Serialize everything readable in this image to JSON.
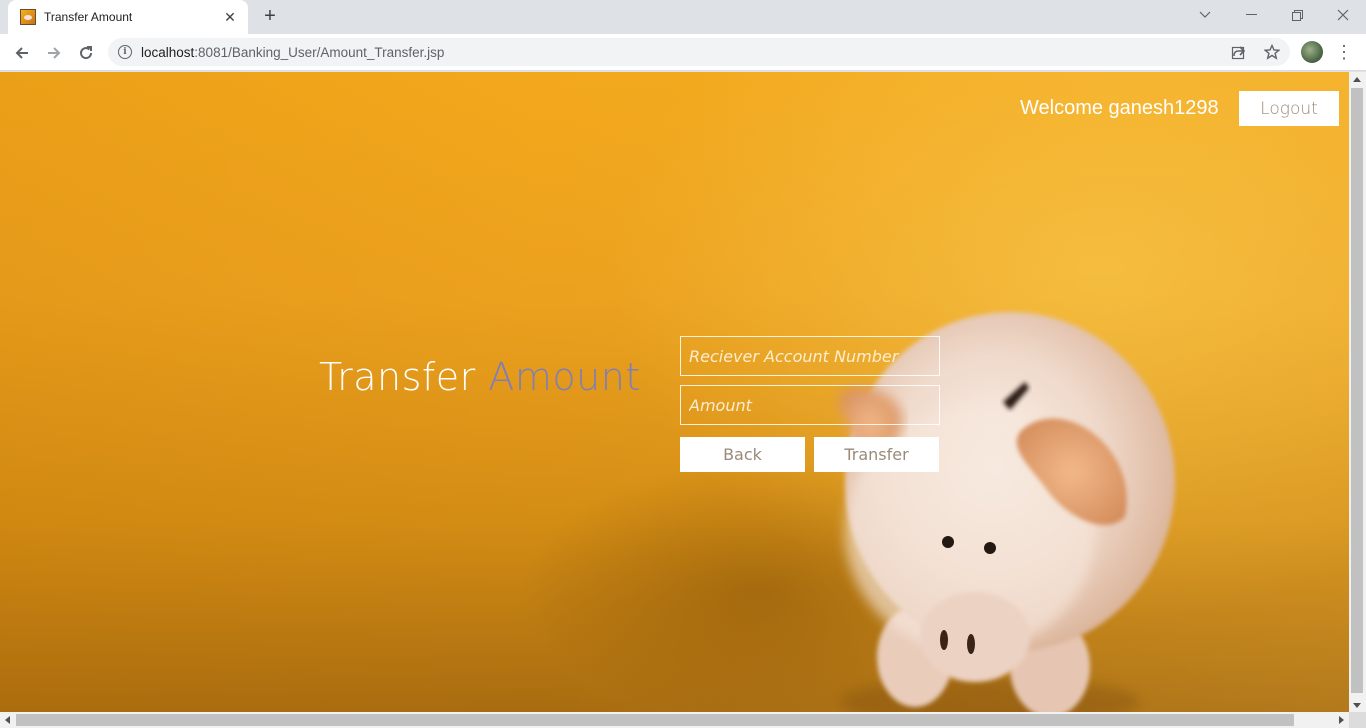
{
  "browser": {
    "tab_title": "Transfer Amount",
    "tab_close_icon": "close-icon",
    "new_tab_icon": "plus-icon",
    "window_controls": [
      "chevron-down-icon",
      "minimize-icon",
      "restore-icon",
      "close-icon"
    ],
    "url_host": "localhost",
    "url_path": ":8081/Banking_User/Amount_Transfer.jsp",
    "toolbar_icons": [
      "back-arrow-icon",
      "forward-arrow-icon",
      "reload-icon",
      "info-icon",
      "share-icon",
      "star-icon",
      "profile-avatar",
      "kebab-menu-icon"
    ]
  },
  "header": {
    "welcome_text": "Welcome ganesh1298",
    "logout_label": "Logout"
  },
  "heading": {
    "word1": "Transfer",
    "word2": "Amount",
    "accent_color": "#7f7eb8"
  },
  "form": {
    "account_placeholder": "Reciever Account Number",
    "account_value": "",
    "amount_placeholder": "Amount",
    "amount_value": "",
    "back_label": "Back",
    "transfer_label": "Transfer"
  },
  "colors": {
    "background": "#eca11e",
    "button_text": "#9a8a78"
  }
}
